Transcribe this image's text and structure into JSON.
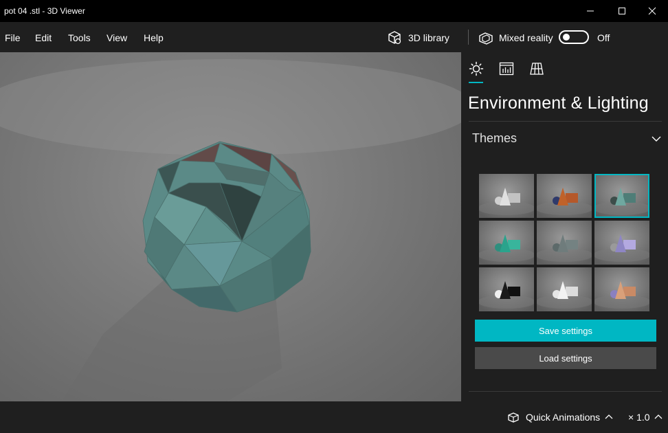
{
  "window": {
    "title": "pot 04 .stl - 3D Viewer",
    "controls": [
      "minimize",
      "maximize",
      "close"
    ]
  },
  "menu": {
    "items": [
      "File",
      "Edit",
      "Tools",
      "View",
      "Help"
    ],
    "library_label": "3D library",
    "mixed_reality_label": "Mixed reality",
    "mixed_reality_state": "Off",
    "mixed_reality_on": false
  },
  "viewport": {
    "model": "pot 04 .stl",
    "background_color": "#7e7e7e",
    "model_color": "#5f8f8c"
  },
  "panel": {
    "tabs": [
      {
        "name": "environment-lighting",
        "icon": "sun-icon",
        "active": true
      },
      {
        "name": "stats",
        "icon": "chart-icon",
        "active": false
      },
      {
        "name": "grid",
        "icon": "grid-icon",
        "active": false
      }
    ],
    "title": "Environment & Lighting",
    "themes_label": "Themes",
    "themes": [
      {
        "id": 1,
        "colors": [
          "#e0e0e0",
          "#cfcfcf",
          "#c2c2c2"
        ],
        "selected": false
      },
      {
        "id": 2,
        "colors": [
          "#c0622a",
          "#2f3a6b",
          "#b5582a"
        ],
        "selected": false
      },
      {
        "id": 3,
        "colors": [
          "#6fa8a0",
          "#3d4d4a",
          "#4e7d77"
        ],
        "selected": true
      },
      {
        "id": 4,
        "colors": [
          "#2aa38c",
          "#2e8f7e",
          "#38b59c"
        ],
        "selected": false
      },
      {
        "id": 5,
        "colors": [
          "#6f7c7c",
          "#5d6a6a",
          "#748282"
        ],
        "selected": false
      },
      {
        "id": 6,
        "colors": [
          "#8e86c4",
          "#9a9a9a",
          "#b3a9e0"
        ],
        "selected": false
      },
      {
        "id": 7,
        "colors": [
          "#1a1a1a",
          "#f0f0f0",
          "#111111"
        ],
        "selected": false
      },
      {
        "id": 8,
        "colors": [
          "#f2f2f2",
          "#e6e6e6",
          "#dcdcdc"
        ],
        "selected": false
      },
      {
        "id": 9,
        "colors": [
          "#d9a07a",
          "#8a80c0",
          "#c98a65"
        ],
        "selected": false
      }
    ],
    "save_label": "Save settings",
    "load_label": "Load settings",
    "accent": "#00b7c3"
  },
  "statusbar": {
    "animations_label": "Quick Animations",
    "speed_label": "× 1.0"
  }
}
